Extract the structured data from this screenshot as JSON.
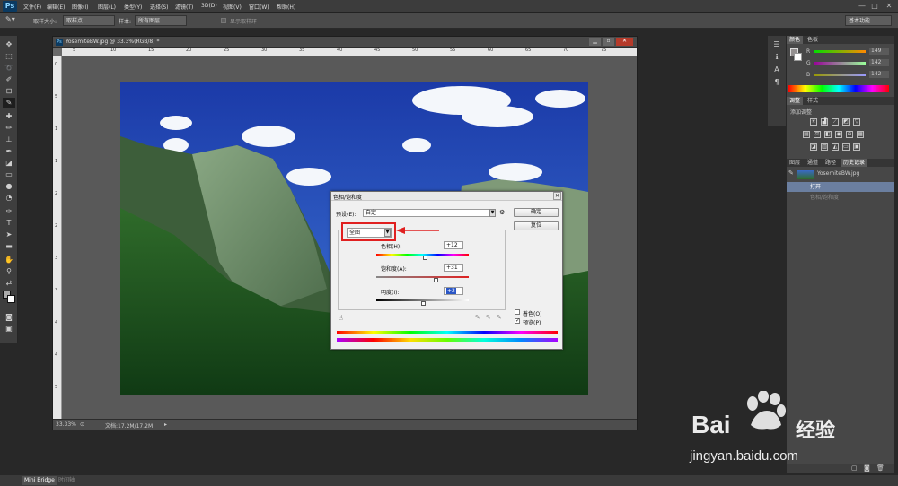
{
  "app": {
    "logo": "Ps"
  },
  "menu": [
    "文件(F)",
    "编辑(E)",
    "图像(I)",
    "图层(L)",
    "类型(Y)",
    "选择(S)",
    "滤镜(T)",
    "3D(D)",
    "视图(V)",
    "窗口(W)",
    "帮助(H)"
  ],
  "window_controls": [
    "—",
    "□",
    "✕"
  ],
  "options": {
    "sample_size_label": "取样大小:",
    "sample_size_value": "取样点",
    "sample_label": "样本:",
    "sample_value": "所有图层",
    "show_ring_label": "显示取样环",
    "workspace": "基本功能"
  },
  "document": {
    "title": "YosemiteBW.jpg @ 33.3%(RGB/8) *",
    "ruler_top": [
      "5",
      "10",
      "15",
      "20",
      "25",
      "30",
      "35",
      "40",
      "45",
      "50",
      "55",
      "60",
      "65",
      "70",
      "75"
    ],
    "ruler_left": [
      "0",
      "5",
      "1",
      "1",
      "2",
      "2",
      "3",
      "3",
      "4",
      "4",
      "5"
    ],
    "zoom": "33.33%",
    "doc_size": "文档:17.2M/17.2M"
  },
  "dialog": {
    "title": "色相/饱和度",
    "preset_label": "预设(E):",
    "preset_value": "自定",
    "ok": "确定",
    "reset": "复位",
    "channel": "全图",
    "hue_label": "色相(H):",
    "hue_value": "+12",
    "hue_level": 0.53,
    "saturation_label": "饱和度(A):",
    "saturation_value": "+31",
    "saturation_level": 0.65,
    "lightness_label": "明度(I):",
    "lightness_value": "+2",
    "lightness_level": 0.51,
    "colorize_label": "着色(O)",
    "colorize_checked": false,
    "preview_label": "预览(P)",
    "preview_checked": true
  },
  "panels": {
    "color_tabs": [
      "颜色",
      "色板"
    ],
    "rgb_labels": [
      "R",
      "G",
      "B"
    ],
    "rgb_values": [
      "149",
      "142",
      "142"
    ],
    "adjust_tabs": [
      "调整",
      "样式"
    ],
    "adjust_title": "添加调整",
    "history_tabs": [
      "图层",
      "通道",
      "路径",
      "历史记录"
    ],
    "history_file": "YosemiteBW.jpg",
    "history_items": [
      "打开",
      "色相/饱和度"
    ]
  },
  "bottom": {
    "tabs": [
      "Mini Bridge",
      "时间轴"
    ]
  },
  "watermark": {
    "brand": "Bai",
    "brand_cn": "经验",
    "url": "jingyan.baidu.com"
  },
  "colors": {
    "ui_dark": "#282828",
    "panel": "#474747",
    "highlight_red": "#e02020"
  }
}
